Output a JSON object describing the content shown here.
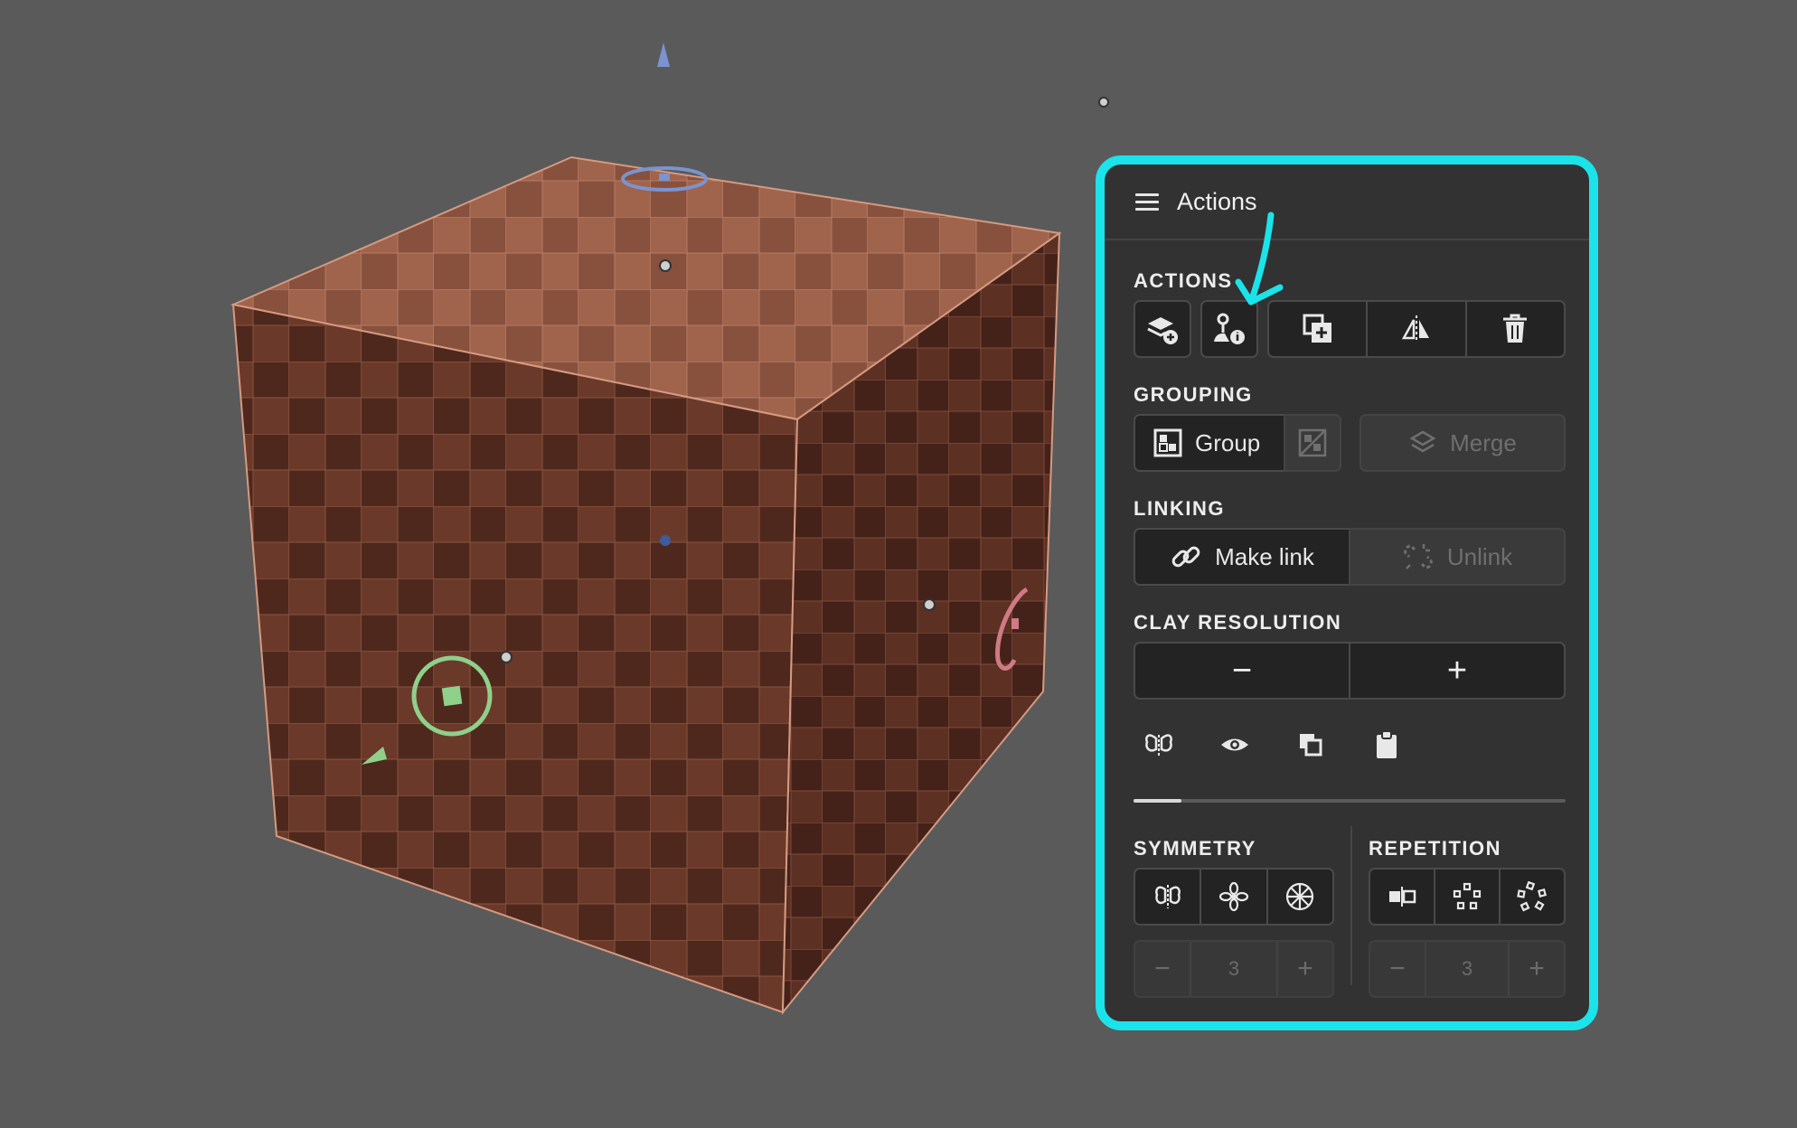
{
  "panel": {
    "title": "Actions",
    "accent_color": "#1be3ea",
    "sections": {
      "actions": "ACTIONS",
      "grouping": "GROUPING",
      "linking": "LINKING",
      "clay_resolution": "CLAY RESOLUTION",
      "symmetry": "SYMMETRY",
      "repetition": "REPETITION"
    },
    "action_icons": [
      "add-layer-icon",
      "object-info-icon",
      "duplicate-icon",
      "mirror-icon",
      "trash-icon"
    ],
    "grouping": {
      "group_label": "Group",
      "merge_label": "Merge"
    },
    "linking": {
      "make_link_label": "Make link",
      "unlink_label": "Unlink"
    },
    "clay_resolution": {
      "minus": "−",
      "plus": "+"
    },
    "tool_icons": [
      "symmetry-butterfly-icon",
      "eye-icon",
      "copy-icon",
      "clipboard-icon"
    ],
    "slider_progress": 0.11,
    "symmetry": {
      "count": "3",
      "minus": "−",
      "plus": "+"
    },
    "repetition": {
      "count": "3",
      "minus": "−",
      "plus": "+"
    }
  },
  "scene": {
    "object_color": "#6d3a2b",
    "gizmo_colors": {
      "y": "#7b93cf",
      "x": "#d07a86",
      "z": "#8fd08b"
    }
  }
}
